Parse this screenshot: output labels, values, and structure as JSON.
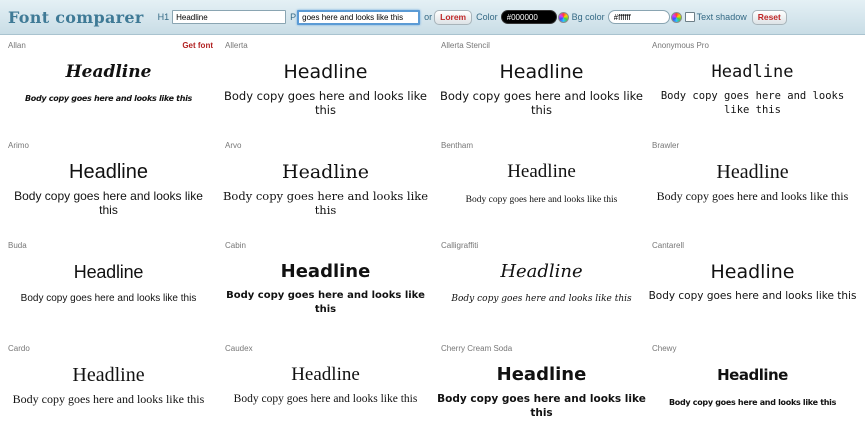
{
  "app": {
    "title": "Font comparer"
  },
  "toolbar": {
    "h1_label": "H1",
    "h1_value": "Headline",
    "p_label": "P",
    "p_value": "goes here and looks like this",
    "or_label": "or",
    "lorem_button": "Lorem",
    "color_label": "Color",
    "color_value": "#000000",
    "bg_color_label": "Bg color",
    "bg_color_value": "#ffffff",
    "text_shadow_label": "Text shadow",
    "reset_button": "Reset"
  },
  "get_font_label": "Get font",
  "sample": {
    "headline": "Headline",
    "body": "Body copy goes here and looks like this"
  },
  "fonts": [
    {
      "name": "Allan",
      "style": "f-allan",
      "show_get_font": true
    },
    {
      "name": "Allerta",
      "style": "f-allerta"
    },
    {
      "name": "Allerta Stencil",
      "style": "f-stencil"
    },
    {
      "name": "Anonymous Pro",
      "style": "f-anon"
    },
    {
      "name": "Arimo",
      "style": "f-arimo"
    },
    {
      "name": "Arvo",
      "style": "f-arvo"
    },
    {
      "name": "Bentham",
      "style": "f-bentham"
    },
    {
      "name": "Brawler",
      "style": "f-brawler"
    },
    {
      "name": "Buda",
      "style": "f-buda"
    },
    {
      "name": "Cabin",
      "style": "f-cabin"
    },
    {
      "name": "Calligraffiti",
      "style": "f-calli"
    },
    {
      "name": "Cantarell",
      "style": "f-cantarell"
    },
    {
      "name": "Cardo",
      "style": "f-cardo"
    },
    {
      "name": "Caudex",
      "style": "f-caudex"
    },
    {
      "name": "Cherry Cream Soda",
      "style": "f-cherry"
    },
    {
      "name": "Chewy",
      "style": "f-chewy"
    }
  ]
}
